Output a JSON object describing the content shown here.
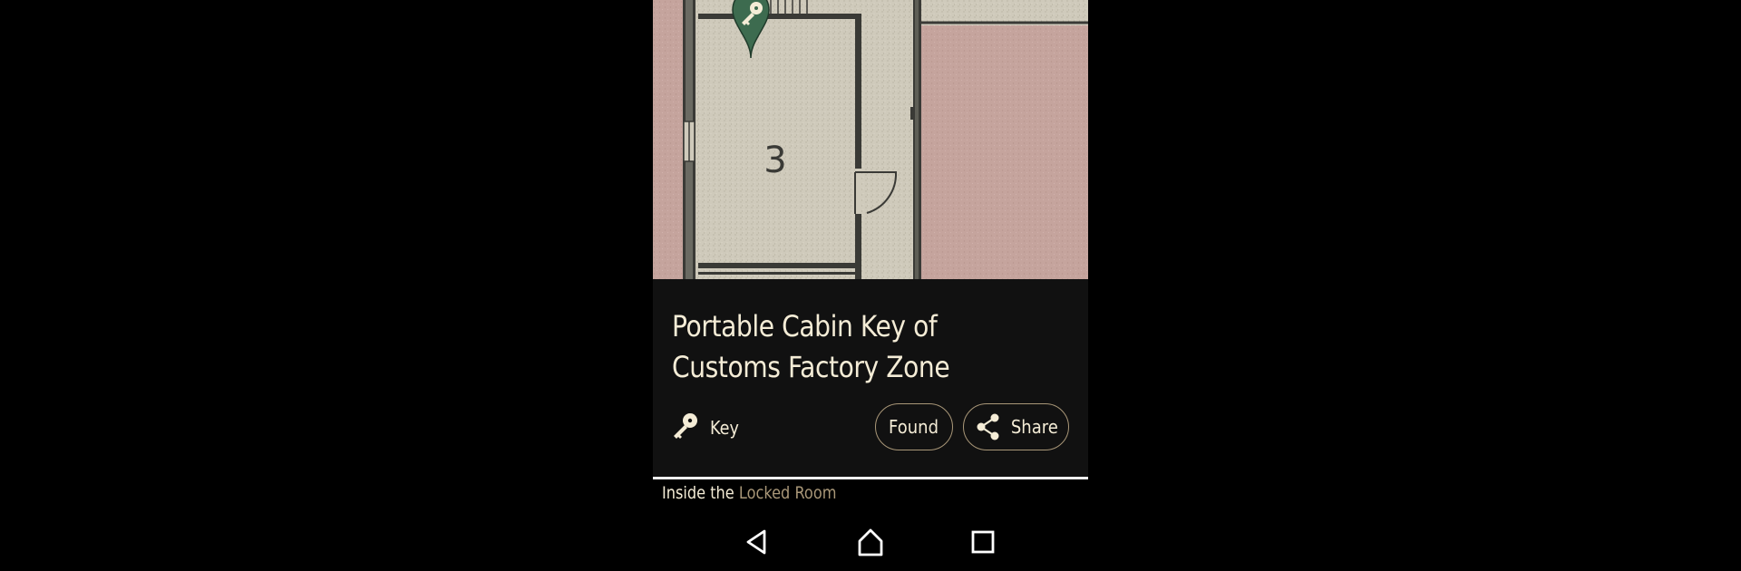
{
  "map": {
    "room_number": "3"
  },
  "item": {
    "title_line1": "Portable Cabin Key of",
    "title_line2": "Customs Factory Zone",
    "type_label": "Key",
    "type_icon": "key-icon"
  },
  "actions": {
    "found_label": "Found",
    "share_label": "Share",
    "share_icon": "share-icon"
  },
  "description": {
    "prefix": "Inside the ",
    "link_text": "Locked Room"
  },
  "navbar": {
    "back_icon": "back-triangle-icon",
    "home_icon": "home-icon",
    "recent_icon": "recent-apps-icon"
  },
  "colors": {
    "panel_bg": "#111111",
    "text_cream": "#f4ecd6",
    "accent_tan": "#a99778",
    "pin_green": "#3d6b4f",
    "map_paper": "#cdc8b8",
    "map_pink": "#c7a6a0"
  }
}
